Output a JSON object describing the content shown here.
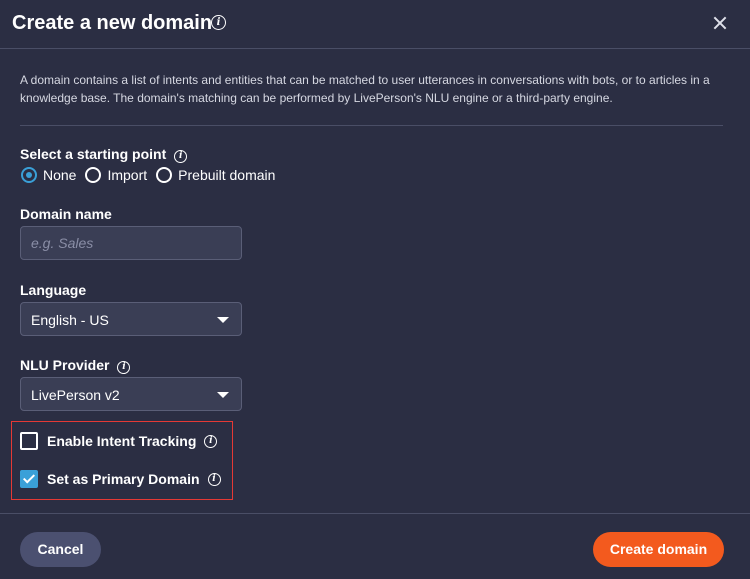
{
  "dialog": {
    "title": "Create a new domain",
    "description": "A domain contains a list of intents and entities that can be matched to user utterances in conversations with bots, or to articles in a knowledge base. The domain's matching can be performed by LivePerson's NLU engine or a third-party engine."
  },
  "starting_point": {
    "label": "Select a starting point",
    "options": [
      {
        "label": "None",
        "selected": true
      },
      {
        "label": "Import",
        "selected": false
      },
      {
        "label": "Prebuilt domain",
        "selected": false
      }
    ]
  },
  "domain_name": {
    "label": "Domain name",
    "placeholder": "e.g. Sales",
    "value": ""
  },
  "language": {
    "label": "Language",
    "value": "English - US"
  },
  "nlu_provider": {
    "label": "NLU Provider",
    "value": "LivePerson v2"
  },
  "options": {
    "intent_tracking": {
      "label": "Enable Intent Tracking",
      "checked": false
    },
    "primary_domain": {
      "label": "Set as Primary Domain",
      "checked": true
    }
  },
  "footer": {
    "cancel_label": "Cancel",
    "create_label": "Create domain"
  },
  "colors": {
    "background": "#2b2e43",
    "accent": "#3aa0d8",
    "primary_button": "#f35a1e",
    "highlight": "#e53935"
  },
  "icons": {
    "info": "info-icon",
    "close": "close-icon",
    "dropdown": "chevron-down-icon"
  }
}
